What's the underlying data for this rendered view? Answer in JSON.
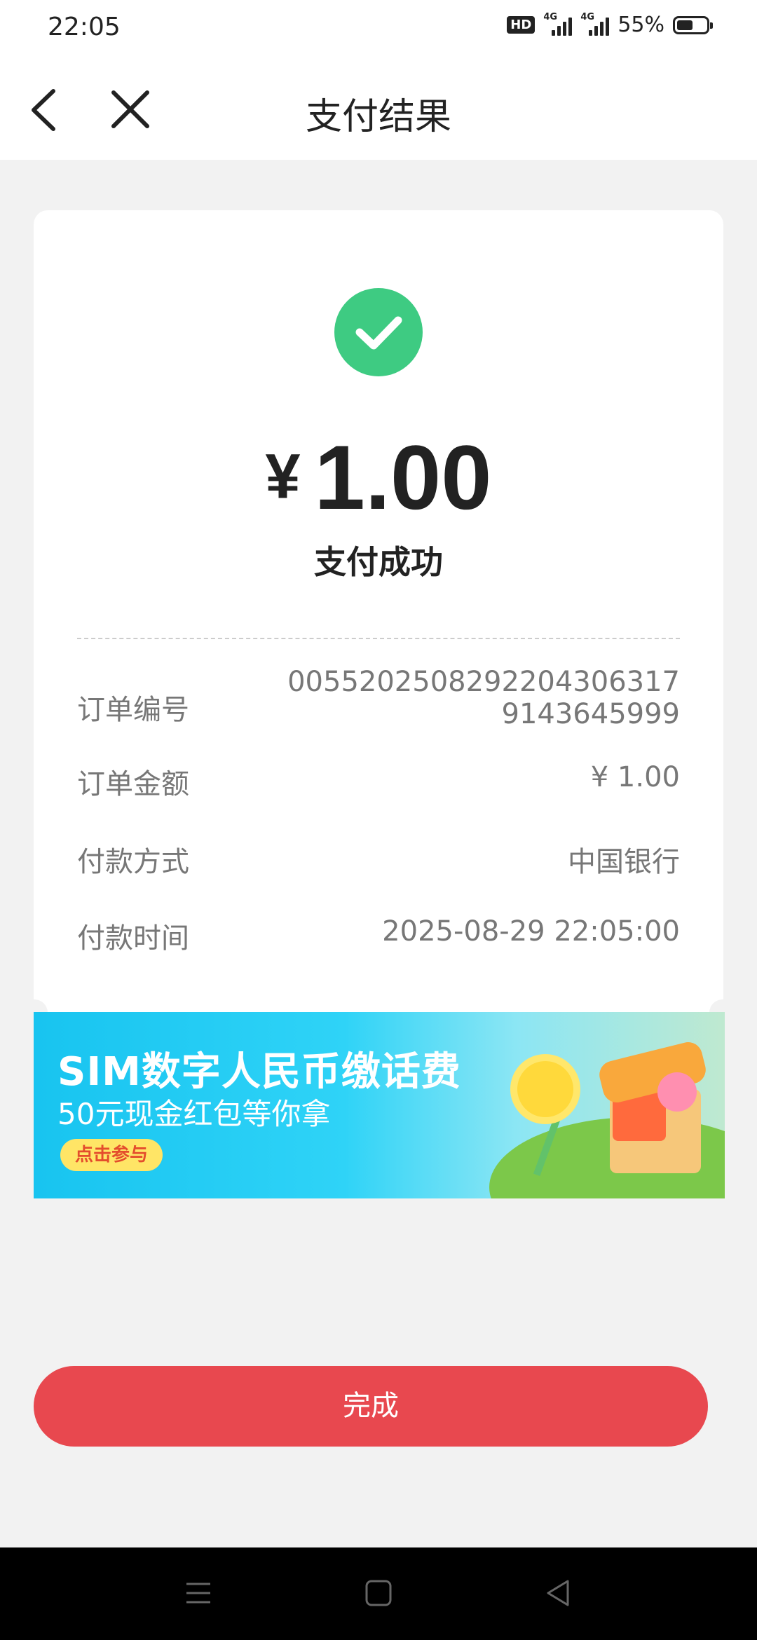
{
  "status_bar": {
    "time": "22:05",
    "hd": "HD",
    "net1": "4G",
    "net2": "4G",
    "battery": "55%"
  },
  "header": {
    "title": "支付结果",
    "back_icon": "chevron-left-icon",
    "close_icon": "close-icon"
  },
  "result": {
    "currency": "¥",
    "amount": "1.00",
    "status": "支付成功",
    "status_color": "#3ecb82",
    "rows": [
      {
        "key": "订单编号",
        "value_line1": "00552025082922043063​17",
        "value_line2": "9143645999"
      },
      {
        "key": "订单金额",
        "value": "¥ 1.00"
      },
      {
        "key": "付款方式",
        "value": "中国银行"
      },
      {
        "key": "付款时间",
        "value": "2025-08-29 22:05:00"
      }
    ]
  },
  "banner": {
    "title": "SIM数字人民币缴话费",
    "subtitle": "50元现金红包等你拿",
    "button": "点击参与"
  },
  "done_button": {
    "label": "完成",
    "color": "#e8484f"
  }
}
